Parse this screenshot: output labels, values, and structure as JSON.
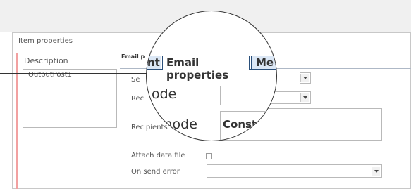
{
  "panel": {
    "title": "Item properties"
  },
  "left": {
    "description_label": "Description",
    "description_value": "OutputPost1"
  },
  "tabs": {
    "small_visible": "Email p"
  },
  "fields": {
    "sender_fragment": "Se",
    "recipient_fragment": "Rec",
    "recipient_label": "Recipients",
    "attach_data_file": "Attach data file",
    "on_send_error": "On send error"
  },
  "magnifier": {
    "tab_left_fragment": "nt",
    "tab_active": "Email properties",
    "tab_right_fragment": "Me",
    "mode_fragment_1": "ode",
    "mode_fragment_2": "mode",
    "constant_fragment": "Const"
  }
}
